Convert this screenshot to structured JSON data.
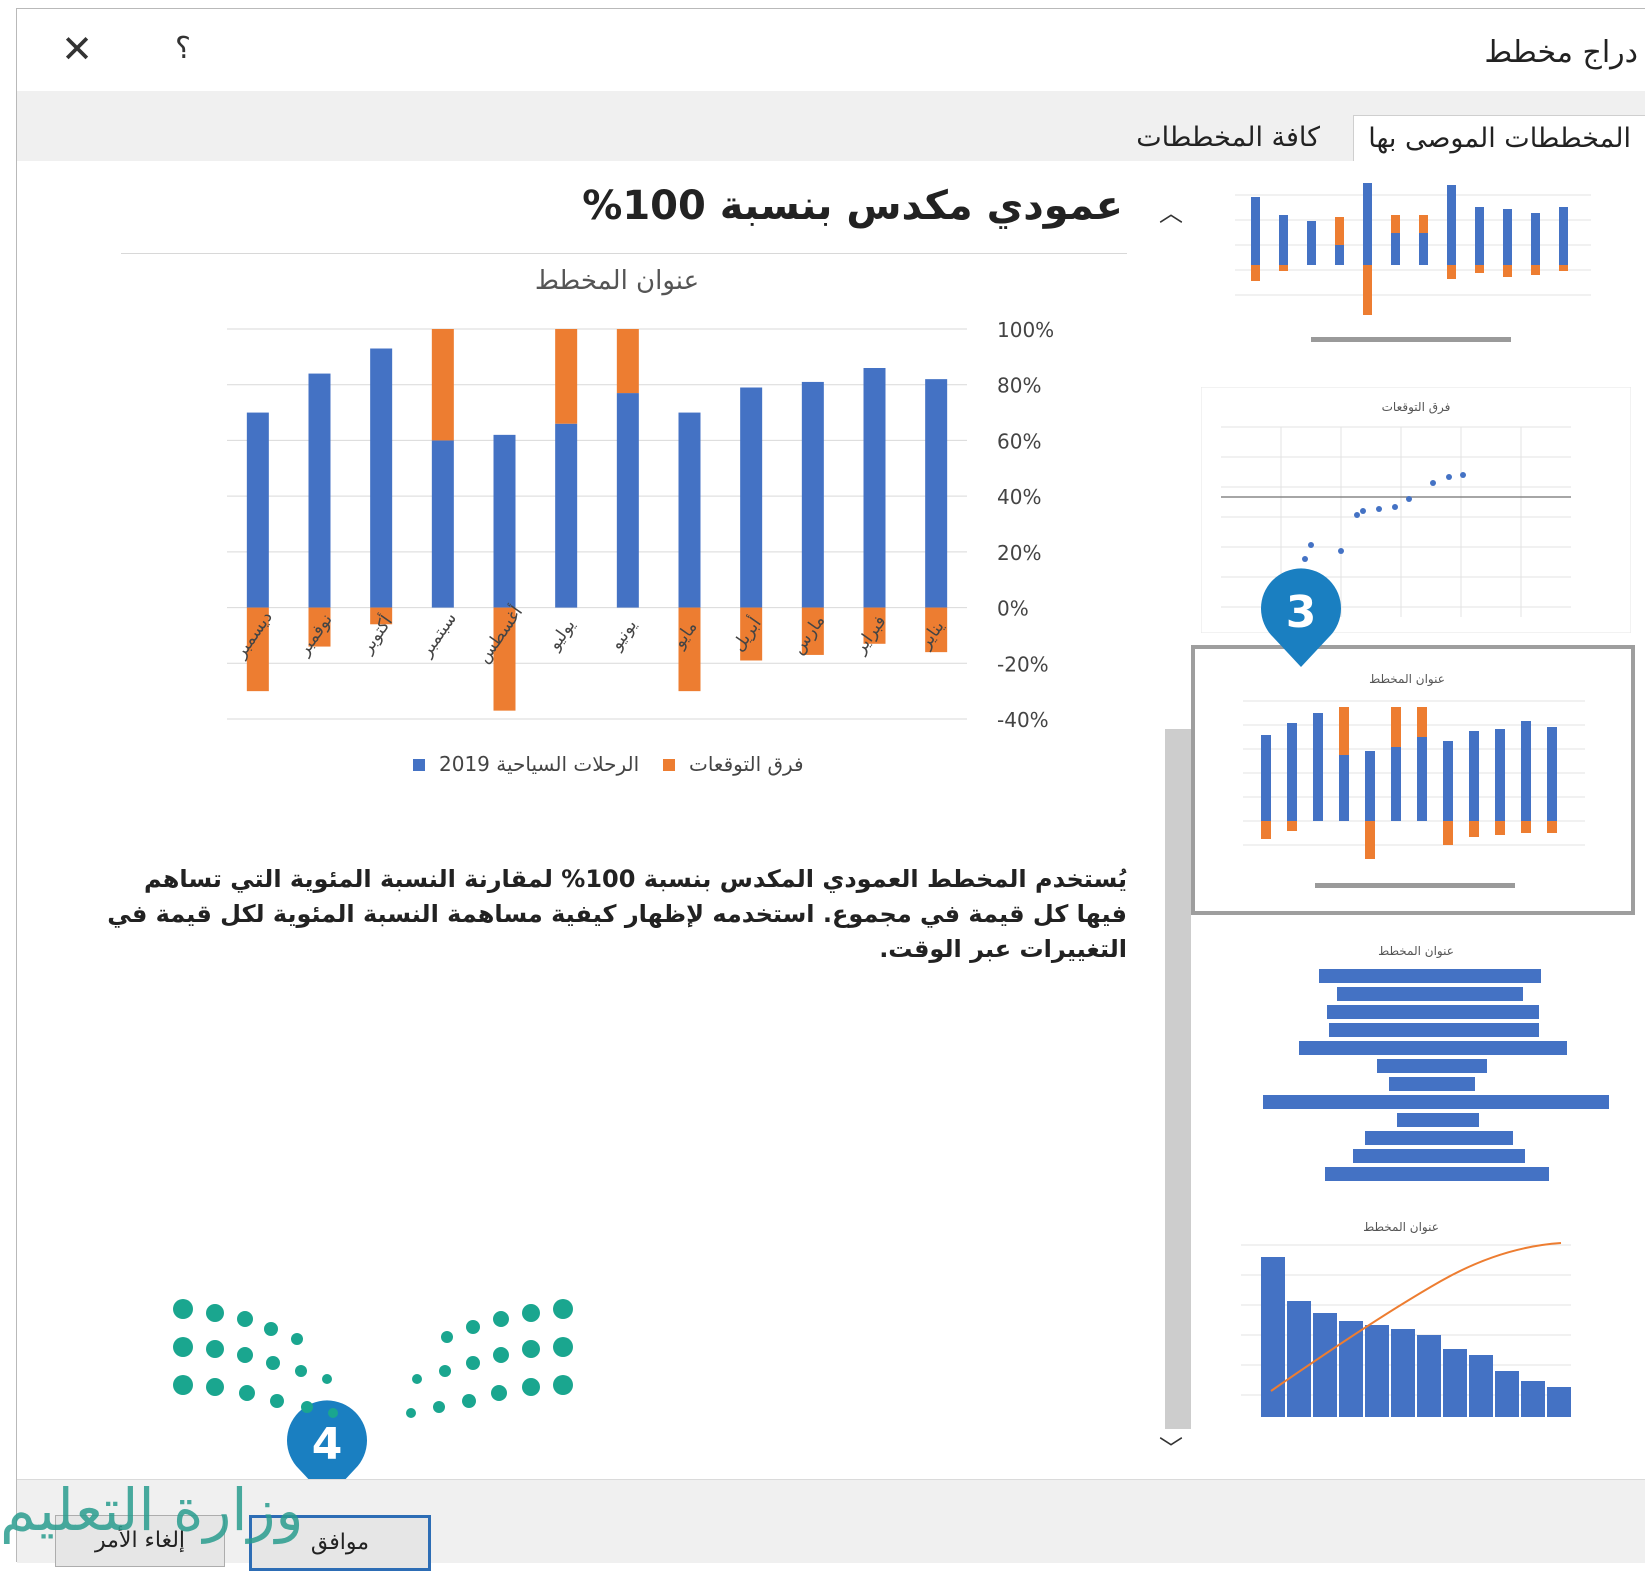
{
  "dialog": {
    "title": "دراج مخطط",
    "close_label": "✕",
    "help_label": "؟"
  },
  "tabs": [
    {
      "label": "المخططات الموصى بها",
      "active": true
    },
    {
      "label": "كافة المخططات",
      "active": false
    }
  ],
  "preview": {
    "title": "عمودي مكدس بنسبة 100%",
    "description": "يُستخدم المخطط العمودي المكدس بنسبة 100% لمقارنة النسبة المئوية التي تساهم فيها كل قيمة في مجموع. استخدمه لإظهار كيفية مساهمة النسبة المئوية لكل قيمة في التغييرات عبر الوقت."
  },
  "chart_data": {
    "type": "bar",
    "title": "عنوان المخطط",
    "categories": [
      "يناير",
      "فبراير",
      "مارس",
      "أبريل",
      "مايو",
      "يونيو",
      "يوليو",
      "أغسطس",
      "سبتمبر",
      "أكتوبر",
      "نوفمبر",
      "ديسمبر"
    ],
    "series": [
      {
        "name": "الرحلات السياحية 2019",
        "color": "#4472c4",
        "values": [
          82,
          86,
          81,
          79,
          70,
          77,
          66,
          62,
          60,
          93,
          84,
          70
        ]
      },
      {
        "name": "فرق التوقعات",
        "color": "#ed7d31",
        "values": [
          -16,
          -13,
          -17,
          -19,
          -30,
          23,
          34,
          -37,
          40,
          -6,
          -14,
          -30
        ]
      }
    ],
    "yticks": [
      "100%",
      "80%",
      "60%",
      "40%",
      "20%",
      "0%",
      "-20%",
      "-40%"
    ],
    "ylim": [
      -40,
      100
    ],
    "legend": "bottom",
    "grid": true
  },
  "thumbnails": [
    {
      "name": "thumb-column",
      "selected": false
    },
    {
      "name": "thumb-scatter",
      "title": "فرق التوقعات",
      "selected": false
    },
    {
      "name": "thumb-stacked-100",
      "title": "عنوان المخطط",
      "selected": true
    },
    {
      "name": "thumb-bar",
      "title": "عنوان المخطط",
      "selected": false
    },
    {
      "name": "thumb-pareto",
      "title": "عنوان المخطط",
      "selected": false
    }
  ],
  "markers": [
    {
      "label": "3",
      "color": "#1a7fc1"
    },
    {
      "label": "4",
      "color": "#1a7fc1"
    }
  ],
  "footer": {
    "ok_label": "موافق",
    "cancel_label": "إلغاء الأمر"
  },
  "watermark": {
    "text": "وزارة التعليم"
  }
}
